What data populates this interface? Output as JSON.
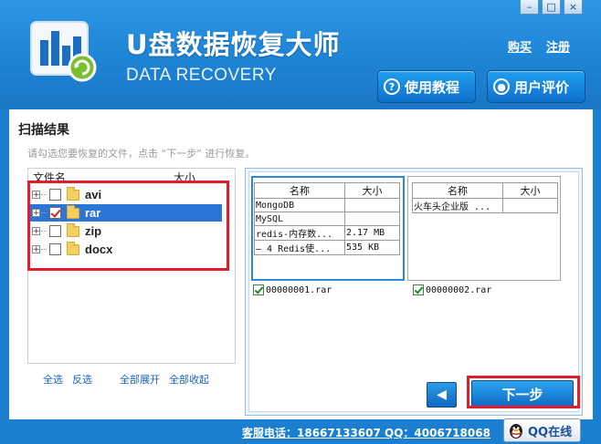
{
  "app": {
    "title": "U盘数据恢复大师",
    "subtitle": "DATA RECOVERY",
    "buy_link": "购买",
    "register_link": "注册",
    "tutorial_button": "使用教程",
    "review_button": "用户评价"
  },
  "window_controls": {
    "minimize": "–",
    "maximize": "□",
    "close": "×"
  },
  "scan": {
    "title": "扫描结果",
    "hint": "请勾选您要恢复的文件，点击 “下一步” 进行恢复。",
    "col_name": "文件名",
    "col_size": "大小",
    "items": [
      {
        "label": "avi",
        "checked": false,
        "selected": false,
        "expander": "+"
      },
      {
        "label": "rar",
        "checked": true,
        "selected": true,
        "expander": "+"
      },
      {
        "label": "zip",
        "checked": false,
        "selected": false,
        "expander": "+"
      },
      {
        "label": "docx",
        "checked": false,
        "selected": false,
        "expander": "+"
      }
    ],
    "links": {
      "select_all": "全选",
      "invert": "反选",
      "expand_all": "全部展开",
      "collapse_all": "全部收起"
    }
  },
  "previews": [
    {
      "header_name": "名称",
      "header_size": "大小",
      "rows": [
        {
          "name": "MongoDB",
          "size": ""
        },
        {
          "name": "MySQL",
          "size": ""
        },
        {
          "name": "redis-内存数...",
          "size": "2.17 MB"
        },
        {
          "name": "— 4 Redis使...",
          "size": "535 KB"
        }
      ],
      "filename": "00000001.rar",
      "checked": true
    },
    {
      "header_name": "名称",
      "header_size": "大小",
      "rows": [
        {
          "name": "火车头企业版 ...",
          "size": ""
        }
      ],
      "filename": "00000002.rar",
      "checked": true
    }
  ],
  "nav": {
    "back_arrow": "◀",
    "next_label": "下一步"
  },
  "footer": {
    "contact": "客服电话：18667133607  QQ：4006718068",
    "qq_label": "QQ在线"
  },
  "colors": {
    "header_blue": "#1e84d6",
    "selection_blue": "#2b74d8",
    "highlight_red": "#e11d2a",
    "link_blue": "#1a62c8"
  }
}
